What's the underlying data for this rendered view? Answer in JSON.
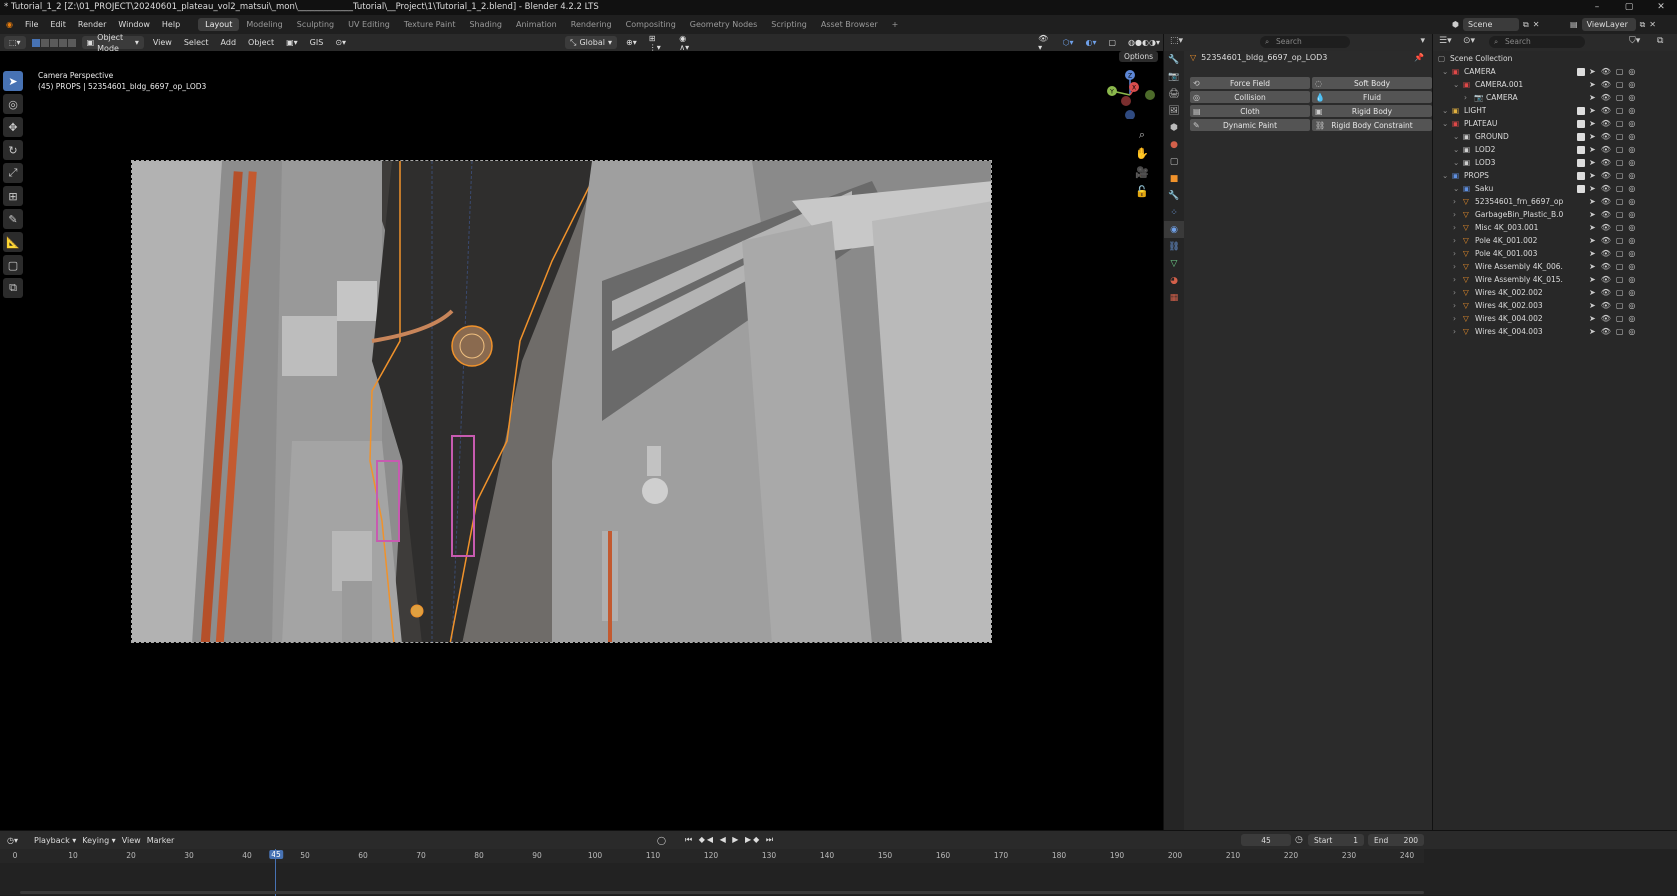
{
  "window": {
    "title": "* Tutorial_1_2 [Z:\\01_PROJECT\\20240601_plateau_vol2_matsui\\_mon\\_____________Tutorial\\__Project\\1\\Tutorial_1_2.blend] - Blender 4.2.2 LTS",
    "min": "–",
    "max": "▢",
    "close": "✕"
  },
  "menu": {
    "items": [
      "File",
      "Edit",
      "Render",
      "Window",
      "Help"
    ],
    "workspaces": [
      "Layout",
      "Modeling",
      "Sculpting",
      "UV Editing",
      "Texture Paint",
      "Shading",
      "Animation",
      "Rendering",
      "Compositing",
      "Geometry Nodes",
      "Scripting",
      "Asset Browser"
    ],
    "active_workspace": "Layout",
    "add_tab": "+",
    "scene_label": "Scene",
    "viewlayer_label": "ViewLayer"
  },
  "viewport_header": {
    "mode": "Object Mode",
    "items": [
      "View",
      "Select",
      "Add",
      "Object"
    ],
    "gis": "GIS",
    "orientation": "Global",
    "options": "Options"
  },
  "viewport": {
    "overlay_line1": "Camera Perspective",
    "overlay_line2": "(45) PROPS | 52354601_bldg_6697_op_LOD3",
    "gizmo_z": "Z",
    "gizmo_y": "Y",
    "gizmo_x": "X"
  },
  "properties": {
    "search_placeholder": "Search",
    "object_name": "52354601_bldg_6697_op_LOD3",
    "physics_buttons": [
      {
        "label": "Force Field",
        "icon": "⟲"
      },
      {
        "label": "Soft Body",
        "icon": "◌"
      },
      {
        "label": "Collision",
        "icon": "◎"
      },
      {
        "label": "Fluid",
        "icon": "💧"
      },
      {
        "label": "Cloth",
        "icon": "▤"
      },
      {
        "label": "Rigid Body",
        "icon": "▣"
      },
      {
        "label": "Dynamic Paint",
        "icon": "✎"
      },
      {
        "label": "Rigid Body Constraint",
        "icon": "⛓"
      }
    ]
  },
  "outliner": {
    "search_placeholder": "Search",
    "root": "Scene Collection",
    "rows": [
      {
        "label": "CAMERA",
        "indent": 1,
        "type": "collection"
      },
      {
        "label": "CAMERA.001",
        "indent": 2,
        "type": "object-cam"
      },
      {
        "label": "CAMERA",
        "indent": 3,
        "type": "camera"
      },
      {
        "label": "LIGHT",
        "indent": 1,
        "type": "collection-y"
      },
      {
        "label": "PLATEAU",
        "indent": 1,
        "type": "collection"
      },
      {
        "label": "GROUND",
        "indent": 2,
        "type": "collection-w"
      },
      {
        "label": "LOD2",
        "indent": 2,
        "type": "collection-w"
      },
      {
        "label": "LOD3",
        "indent": 2,
        "type": "collection-w"
      },
      {
        "label": "PROPS",
        "indent": 1,
        "type": "collection-b"
      },
      {
        "label": "Saku",
        "indent": 2,
        "type": "collection-b"
      },
      {
        "label": "52354601_frn_6697_op",
        "indent": 2,
        "type": "mesh"
      },
      {
        "label": "GarbageBin_Plastic_B.0",
        "indent": 2,
        "type": "mesh"
      },
      {
        "label": "Misc 4K_003.001",
        "indent": 2,
        "type": "mesh"
      },
      {
        "label": "Pole 4K_001.002",
        "indent": 2,
        "type": "mesh"
      },
      {
        "label": "Pole 4K_001.003",
        "indent": 2,
        "type": "mesh"
      },
      {
        "label": "Wire Assembly 4K_006.",
        "indent": 2,
        "type": "mesh"
      },
      {
        "label": "Wire Assembly 4K_015.",
        "indent": 2,
        "type": "mesh"
      },
      {
        "label": "Wires 4K_002.002",
        "indent": 2,
        "type": "mesh"
      },
      {
        "label": "Wires 4K_002.003",
        "indent": 2,
        "type": "mesh"
      },
      {
        "label": "Wires 4K_004.002",
        "indent": 2,
        "type": "mesh"
      },
      {
        "label": "Wires 4K_004.003",
        "indent": 2,
        "type": "mesh"
      }
    ]
  },
  "timeline": {
    "menus": [
      "Playback",
      "Keying",
      "View",
      "Marker"
    ],
    "current_frame": "45",
    "start_label": "Start",
    "start_value": "1",
    "end_label": "End",
    "end_value": "200",
    "ticks": [
      "0",
      "10",
      "20",
      "30",
      "40",
      "50",
      "60",
      "70",
      "80",
      "90",
      "100",
      "110",
      "120",
      "130",
      "140",
      "150",
      "160",
      "170",
      "180",
      "190",
      "200",
      "210",
      "220",
      "230",
      "240"
    ]
  },
  "colors": {
    "accent": "#4772b3",
    "selection": "#f0922b",
    "collection_red": "#e04848"
  }
}
